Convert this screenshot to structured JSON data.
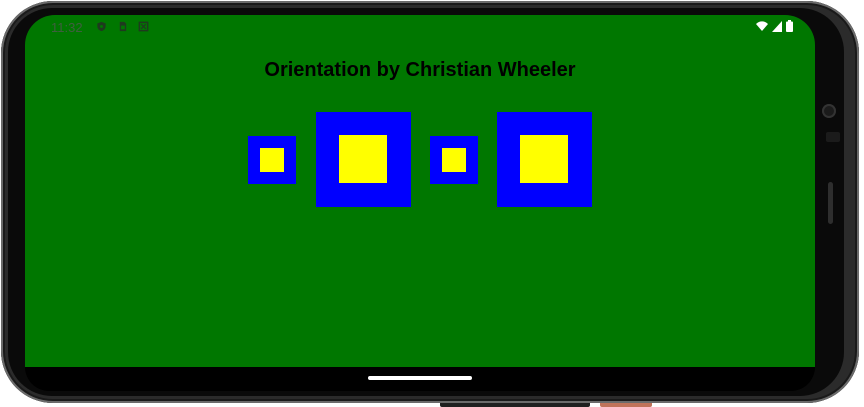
{
  "status_bar": {
    "time": "11:32",
    "left_icons": [
      "shield-icon",
      "sim-card-icon",
      "notification-icon"
    ],
    "right_icons": [
      "wifi-icon",
      "signal-icon",
      "battery-icon"
    ]
  },
  "app": {
    "title": "Orientation by Christian Wheeler",
    "background_color": "#007700",
    "outer_color": "#0000ff",
    "inner_color": "#ffff00"
  },
  "squares": [
    "small-square",
    "large-square",
    "small-square",
    "large-square"
  ]
}
